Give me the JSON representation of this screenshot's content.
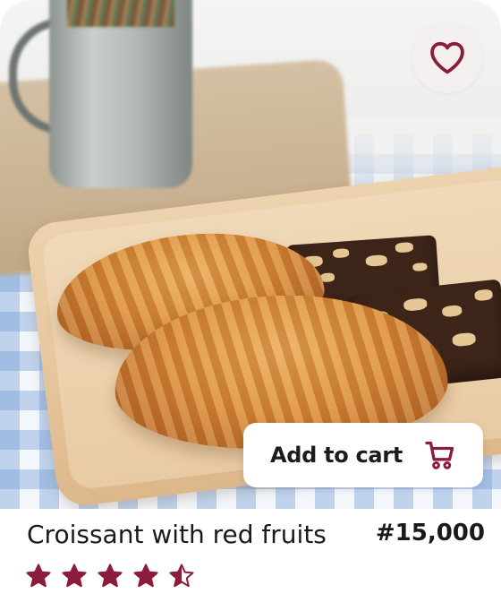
{
  "product": {
    "name": "Croissant with red fruits",
    "price": "#15,000",
    "rating": 4.5,
    "rating_max": 5
  },
  "actions": {
    "add_to_cart_label": "Add to cart",
    "cart_icon": "shopping-cart-icon",
    "favorite_icon": "heart-icon"
  },
  "colors": {
    "accent": "#8b1d3b",
    "card_background": "#ffffff",
    "favorite_button_bg": "#f2efee"
  }
}
